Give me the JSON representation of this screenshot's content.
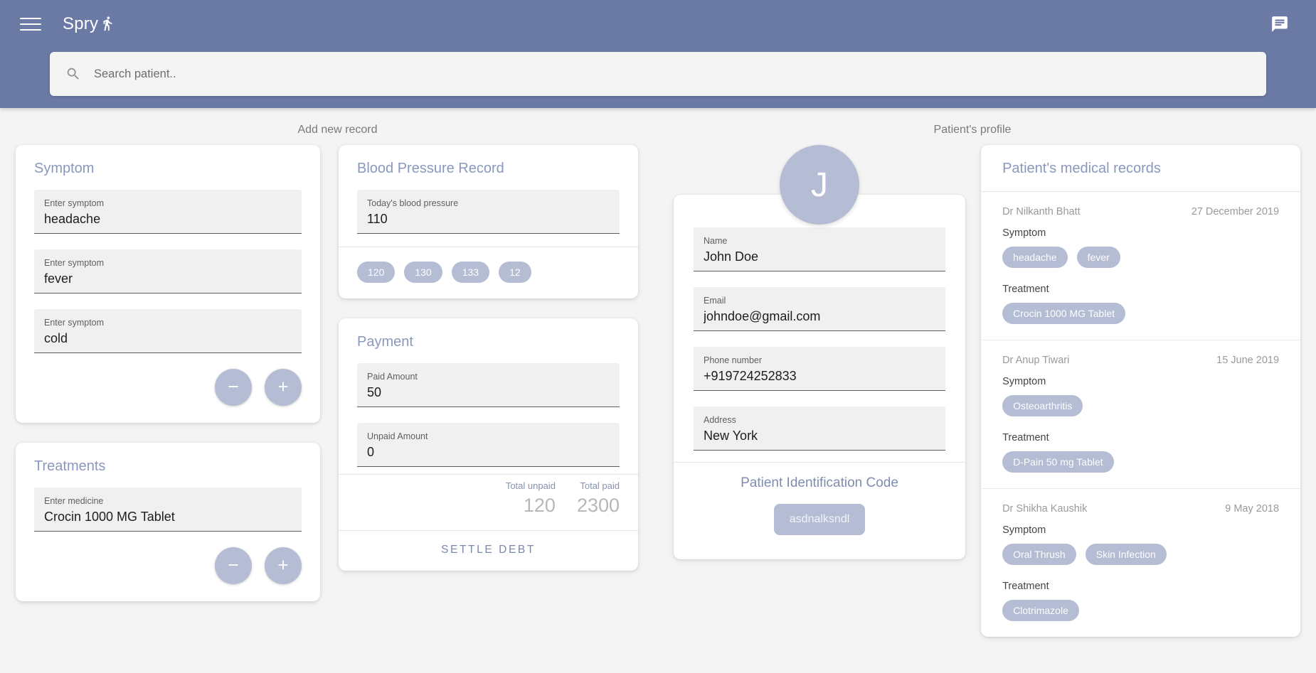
{
  "appbar": {
    "menu_icon": "hamburger-menu-icon",
    "brand": "Spry",
    "brand_icon": "running-person-icon",
    "chat_icon": "chat-bubble-icon",
    "background": "#6b7aa5"
  },
  "search": {
    "placeholder": "Search patient..",
    "value": "",
    "icon": "search-icon"
  },
  "sections": {
    "add_record": "Add new record",
    "patient_profile": "Patient's profile"
  },
  "symptom_card": {
    "title": "Symptom",
    "fields": [
      {
        "label": "Enter symptom",
        "value": "headache"
      },
      {
        "label": "Enter symptom",
        "value": "fever"
      },
      {
        "label": "Enter symptom",
        "value": "cold"
      }
    ],
    "remove_label": "remove-icon",
    "add_label": "add-icon"
  },
  "treatments_card": {
    "title": "Treatments",
    "fields": [
      {
        "label": "Enter medicine",
        "value": "Crocin 1000 MG Tablet"
      }
    ]
  },
  "bp_card": {
    "title": "Blood Pressure Record",
    "field": {
      "label": "Today's blood pressure",
      "value": "110"
    },
    "history": [
      "120",
      "130",
      "133",
      "12"
    ]
  },
  "payment_card": {
    "title": "Payment",
    "paid": {
      "label": "Paid Amount",
      "value": "50"
    },
    "unpaid": {
      "label": "Unpaid Amount",
      "value": "0"
    },
    "total_unpaid_label": "Total unpaid",
    "total_unpaid_value": "120",
    "total_paid_label": "Total paid",
    "total_paid_value": "2300",
    "settle_label": "SETTLE DEBT"
  },
  "profile": {
    "avatar_initial": "J",
    "fields": [
      {
        "label": "Name",
        "value": "John Doe"
      },
      {
        "label": "Email",
        "value": "johndoe@gmail.com"
      },
      {
        "label": "Phone number",
        "value": "+919724252833"
      },
      {
        "label": "Address",
        "value": "New York"
      }
    ],
    "pid_title": "Patient Identification Code",
    "pid_code": "asdnalksndl"
  },
  "records": {
    "title": "Patient's medical records",
    "symptom_label": "Symptom",
    "treatment_label": "Treatment",
    "items": [
      {
        "doctor": "Dr Nilkanth Bhatt",
        "date": "27 December 2019",
        "symptoms": [
          "headache",
          "fever"
        ],
        "treatments": [
          "Crocin 1000 MG Tablet"
        ]
      },
      {
        "doctor": "Dr Anup Tiwari",
        "date": "15 June 2019",
        "symptoms": [
          "Osteoarthritis"
        ],
        "treatments": [
          "D-Pain 50 mg Tablet"
        ]
      },
      {
        "doctor": "Dr Shikha Kaushik",
        "date": "9 May 2018",
        "symptoms": [
          "Oral Thrush",
          "Skin Infection"
        ],
        "treatments": [
          "Clotrimazole"
        ]
      }
    ]
  },
  "colors": {
    "accent": "#6b7aa5",
    "chip": "#b5bdd4",
    "title": "#8b98bd"
  }
}
